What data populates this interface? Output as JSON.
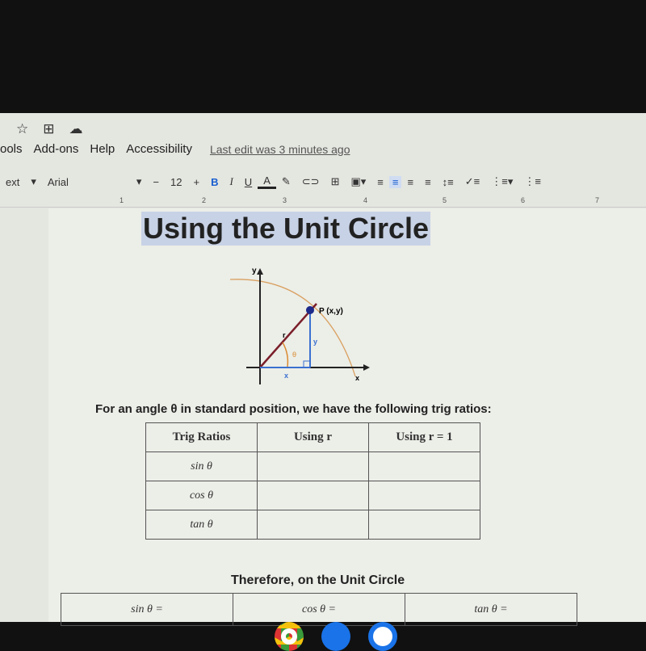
{
  "top_icons": [
    "star-icon",
    "move-to-folder-icon",
    "cloud-status-icon"
  ],
  "menu": {
    "items": [
      "ools",
      "Add-ons",
      "Help",
      "Accessibility"
    ],
    "last_edit": "Last edit was 3 minutes ago"
  },
  "toolbar": {
    "style": "ext",
    "font": "Arial",
    "minus": "−",
    "size": "12",
    "plus": "+",
    "bold": "B",
    "italic": "I",
    "underline": "U",
    "color": "A"
  },
  "ruler": [
    "1",
    "2",
    "3",
    "4",
    "5",
    "6",
    "7"
  ],
  "doc": {
    "title": "Using the Unit Circle",
    "figure": {
      "y": "y",
      "x_axis": "x",
      "point": "P (x,y)",
      "r": "r",
      "y_side": "y",
      "x_side": "x",
      "theta": "θ"
    },
    "caption": "For an angle θ in standard position, we have the following trig ratios:",
    "table1": {
      "headers": [
        "Trig Ratios",
        "Using r",
        "Using r = 1"
      ],
      "rows": [
        "sin θ",
        "cos θ",
        "tan θ"
      ]
    },
    "caption2": "Therefore, on the Unit Circle",
    "table2": [
      "sin θ  =",
      "cos θ  =",
      "tan θ  ="
    ]
  },
  "dock": [
    "chrome-icon",
    "files-icon",
    "docs-icon"
  ]
}
